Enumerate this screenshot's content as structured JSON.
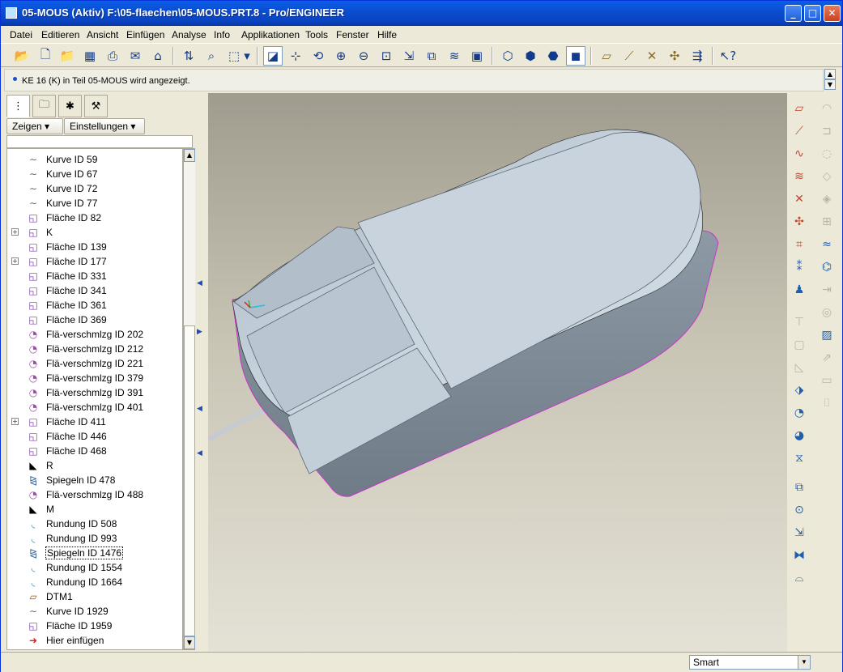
{
  "window": {
    "title": "05-MOUS (Aktiv) F:\\05-flaechen\\05-MOUS.PRT.8 - Pro/ENGINEER",
    "min_icon": "minimize-icon",
    "max_icon": "maximize-icon",
    "close_icon": "close-icon"
  },
  "menu": [
    "Datei",
    "Editieren",
    "Ansicht",
    "Einfügen",
    "Analyse",
    "Info",
    "Applikationen",
    "Tools",
    "Fenster",
    "Hilfe"
  ],
  "message": "KE 16 (K) in Teil 05-MOUS wird angezeigt.",
  "nav": {
    "show_label": "Zeigen",
    "settings_label": "Einstellungen",
    "tabs": [
      "model-tree-icon",
      "folder-browser-icon",
      "favorites-icon",
      "connections-icon"
    ]
  },
  "tree": [
    {
      "label": "Kurve ID 59",
      "icon": "curve-icon",
      "expand": false
    },
    {
      "label": "Kurve ID 67",
      "icon": "curve-icon",
      "expand": false
    },
    {
      "label": "Kurve ID 72",
      "icon": "curve-icon",
      "expand": false
    },
    {
      "label": "Kurve ID 77",
      "icon": "curve-icon",
      "expand": false
    },
    {
      "label": "Fläche ID 82",
      "icon": "surface-icon",
      "expand": false
    },
    {
      "label": "K",
      "icon": "surface-icon",
      "expand": true
    },
    {
      "label": "Fläche ID 139",
      "icon": "surface-icon",
      "expand": false
    },
    {
      "label": "Fläche ID 177",
      "icon": "surface-icon",
      "expand": true
    },
    {
      "label": "Fläche ID 331",
      "icon": "surface-icon",
      "expand": false
    },
    {
      "label": "Fläche ID 341",
      "icon": "surface-icon",
      "expand": false
    },
    {
      "label": "Fläche ID 361",
      "icon": "surface-icon",
      "expand": false
    },
    {
      "label": "Fläche ID 369",
      "icon": "surface-icon",
      "expand": false
    },
    {
      "label": "Flä-verschmlzg ID 202",
      "icon": "merge-icon",
      "expand": false
    },
    {
      "label": "Flä-verschmlzg ID 212",
      "icon": "merge-icon",
      "expand": false
    },
    {
      "label": "Flä-verschmlzg ID 221",
      "icon": "merge-icon",
      "expand": false
    },
    {
      "label": "Flä-verschmlzg ID 379",
      "icon": "merge-icon",
      "expand": false
    },
    {
      "label": "Flä-verschmlzg ID 391",
      "icon": "merge-icon",
      "expand": false
    },
    {
      "label": "Flä-verschmlzg ID 401",
      "icon": "merge-icon",
      "expand": false
    },
    {
      "label": "Fläche ID 411",
      "icon": "surface-icon",
      "expand": true
    },
    {
      "label": "Fläche ID 446",
      "icon": "surface-icon",
      "expand": false
    },
    {
      "label": "Fläche ID 468",
      "icon": "surface-icon",
      "expand": false
    },
    {
      "label": "R",
      "icon": "group-icon",
      "expand": false
    },
    {
      "label": "Spiegeln ID 478",
      "icon": "mirror-icon",
      "expand": false
    },
    {
      "label": "Flä-verschmlzg ID 488",
      "icon": "merge-icon",
      "expand": false
    },
    {
      "label": "M",
      "icon": "group-icon",
      "expand": false
    },
    {
      "label": "Rundung ID 508",
      "icon": "round-icon",
      "expand": false
    },
    {
      "label": "Rundung ID 993",
      "icon": "round-icon",
      "expand": false
    },
    {
      "label": "Spiegeln ID 1476",
      "icon": "mirror-icon",
      "expand": false,
      "focused": true
    },
    {
      "label": "Rundung ID 1554",
      "icon": "round-icon",
      "expand": false
    },
    {
      "label": "Rundung ID 1664",
      "icon": "round-icon",
      "expand": false
    },
    {
      "label": "DTM1",
      "icon": "datum-plane-icon",
      "expand": false
    },
    {
      "label": "Kurve ID 1929",
      "icon": "curve-icon",
      "expand": false
    },
    {
      "label": "Fläche ID 1959",
      "icon": "surface-icon",
      "expand": false
    },
    {
      "label": "Hier einfügen",
      "icon": "insert-here-arrow-icon",
      "expand": false
    }
  ],
  "status": {
    "filter_value": "Smart"
  },
  "colors": {
    "titlebar": "#0a5ee8",
    "model": "#b9c8d4",
    "edge_highlight": "#cc33cc",
    "viewport_top": "#9f9b8e",
    "viewport_bottom": "#e4e1d6"
  }
}
